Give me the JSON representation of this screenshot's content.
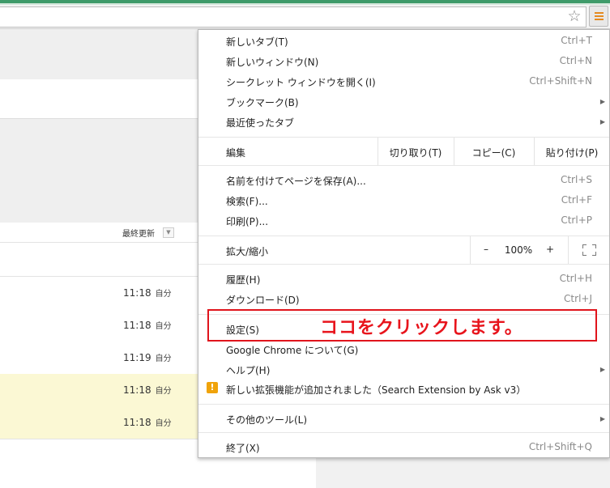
{
  "browser": {
    "bookmark_icon": "star-icon",
    "menu_icon": "hamburger-menu-icon"
  },
  "page": {
    "column_header": "最終更新",
    "rows": [
      {
        "time": "11:18",
        "who": "自分"
      },
      {
        "time": "11:18",
        "who": "自分"
      },
      {
        "time": "11:19",
        "who": "自分"
      },
      {
        "time": "11:18",
        "who": "自分"
      },
      {
        "time": "11:18",
        "who": "自分"
      }
    ]
  },
  "menu": {
    "new_tab": {
      "label": "新しいタブ(T)",
      "shortcut": "Ctrl+T"
    },
    "new_window": {
      "label": "新しいウィンドウ(N)",
      "shortcut": "Ctrl+N"
    },
    "incognito": {
      "label": "シークレット ウィンドウを開く(I)",
      "shortcut": "Ctrl+Shift+N"
    },
    "bookmarks": {
      "label": "ブックマーク(B)"
    },
    "recent_tabs": {
      "label": "最近使ったタブ"
    },
    "edit": {
      "label": "編集",
      "cut": "切り取り(T)",
      "copy": "コピー(C)",
      "paste": "貼り付け(P)"
    },
    "save_page": {
      "label": "名前を付けてページを保存(A)...",
      "shortcut": "Ctrl+S"
    },
    "find": {
      "label": "検索(F)...",
      "shortcut": "Ctrl+F"
    },
    "print": {
      "label": "印刷(P)...",
      "shortcut": "Ctrl+P"
    },
    "zoom": {
      "label": "拡大/縮小",
      "minus": "–",
      "level": "100%",
      "plus": "+"
    },
    "history": {
      "label": "履歴(H)",
      "shortcut": "Ctrl+H"
    },
    "downloads": {
      "label": "ダウンロード(D)",
      "shortcut": "Ctrl+J"
    },
    "settings": {
      "label": "設定(S)"
    },
    "about": {
      "label": "Google Chrome について(G)"
    },
    "help": {
      "label": "ヘルプ(H)"
    },
    "extension_notice": {
      "label": "新しい拡張機能が追加されました（Search Extension by Ask v3）",
      "warn_glyph": "!"
    },
    "more_tools": {
      "label": "その他のツール(L)"
    },
    "exit": {
      "label": "終了(X)",
      "shortcut": "Ctrl+Shift+Q"
    }
  },
  "annotation": {
    "text": "ココをクリックします。",
    "color": "#e8141c"
  }
}
